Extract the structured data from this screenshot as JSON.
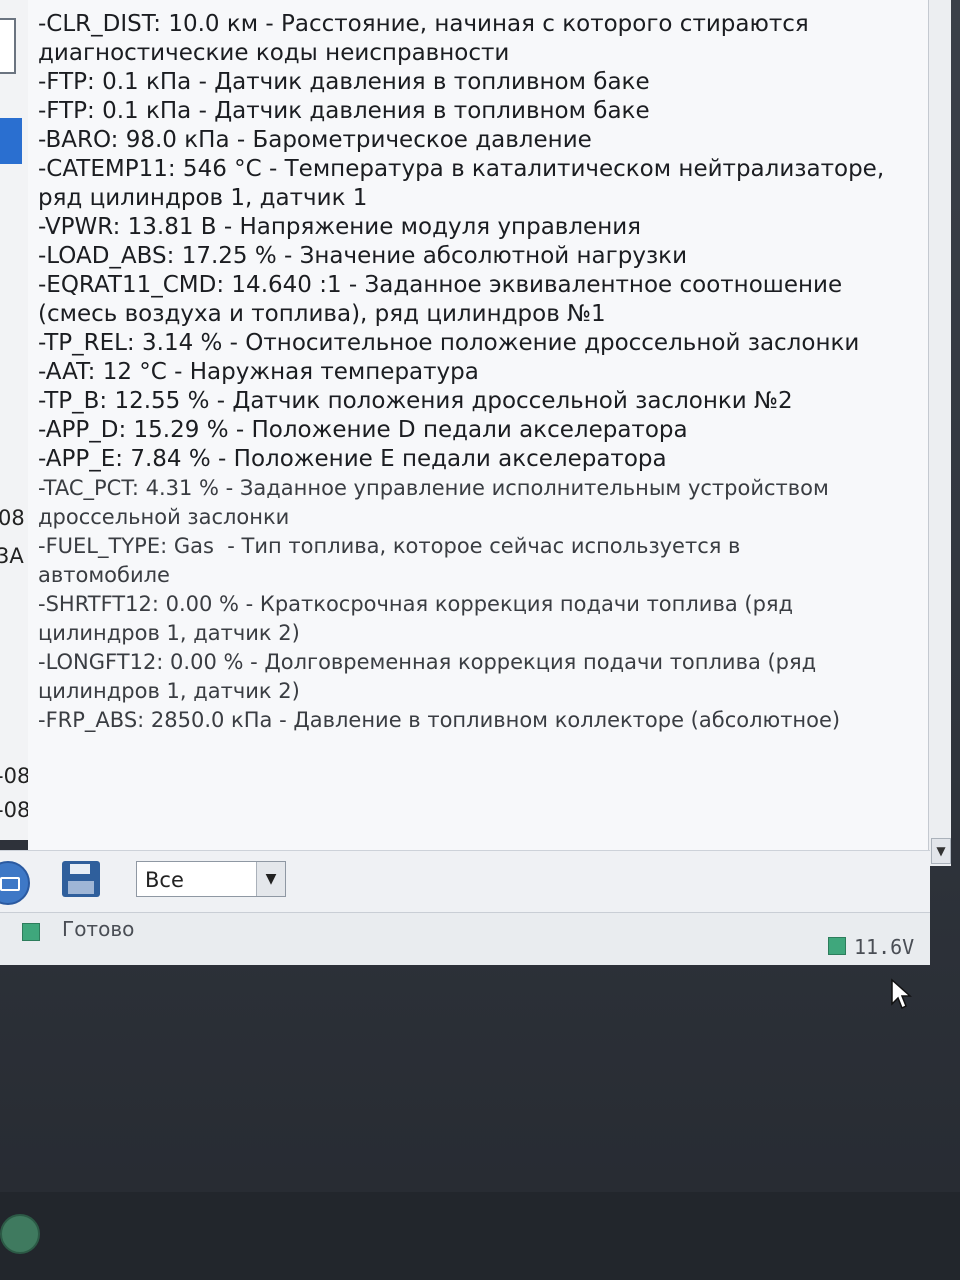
{
  "log": {
    "lines": [
      "-CLR_DIST: 10.0 км - Расстояние, начиная с которого стираются",
      "диагностические коды неисправности",
      "-FTP: 0.1 кПа - Датчик давления в топливном баке",
      "-FTP: 0.1 кПа - Датчик давления в топливном баке",
      "-BARO: 98.0 кПа - Барометрическое давление",
      "-CATEMP11: 546 °C - Температура в каталитическом нейтрализаторе,",
      "ряд цилиндров 1, датчик 1",
      "-VPWR: 13.81 В - Напряжение модуля управления",
      "-LOAD_ABS: 17.25 % - Значение абсолютной нагрузки",
      "-EQRAT11_CMD: 14.640 :1 - Заданное эквивалентное соотношение",
      "(смесь воздуха и топлива), ряд цилиндров №1",
      "-TP_REL: 3.14 % - Относительное положение дроссельной заслонки",
      "-AAT: 12 °C - Наружная температура",
      "-TP_B: 12.55 % - Датчик положения дроссельной заслонки №2",
      "-APP_D: 15.29 % - Положение D педали акселератора",
      "-APP_E: 7.84 % - Положение E педали акселератора",
      "-TAC_PCT: 4.31 % - Заданное управление исполнительным устройством",
      "дроссельной заслонки",
      "-FUEL_TYPE: Gas  - Тип топлива, которое сейчас используется в",
      "автомобиле",
      "-SHRTFT12: 0.00 % - Краткосрочная коррекция подачи топлива (ряд",
      "цилиндров 1, датчик 2)",
      "-LONGFT12: 0.00 % - Долговременная коррекция подачи топлива (ряд",
      "цилиндров 1, датчик 2)",
      "-FRP_ABS: 2850.0 кПа - Давление в топливном коллекторе (абсолютное)"
    ]
  },
  "left_fragments": {
    "f1": "08",
    "f2": "3A",
    "f3": "-08",
    "f4": "-08"
  },
  "toolbar": {
    "filter_value": "Все"
  },
  "status": {
    "text": "Готово",
    "voltage": "11.6V"
  },
  "colors": {
    "status_indicator": "#3fa77c",
    "selection_blue": "#2a6fd0"
  },
  "icons": {
    "save": "floppy-disk-icon",
    "print": "printer-icon",
    "dropdown": "chevron-down-icon",
    "scroll": "scroll-down-arrow-icon"
  }
}
